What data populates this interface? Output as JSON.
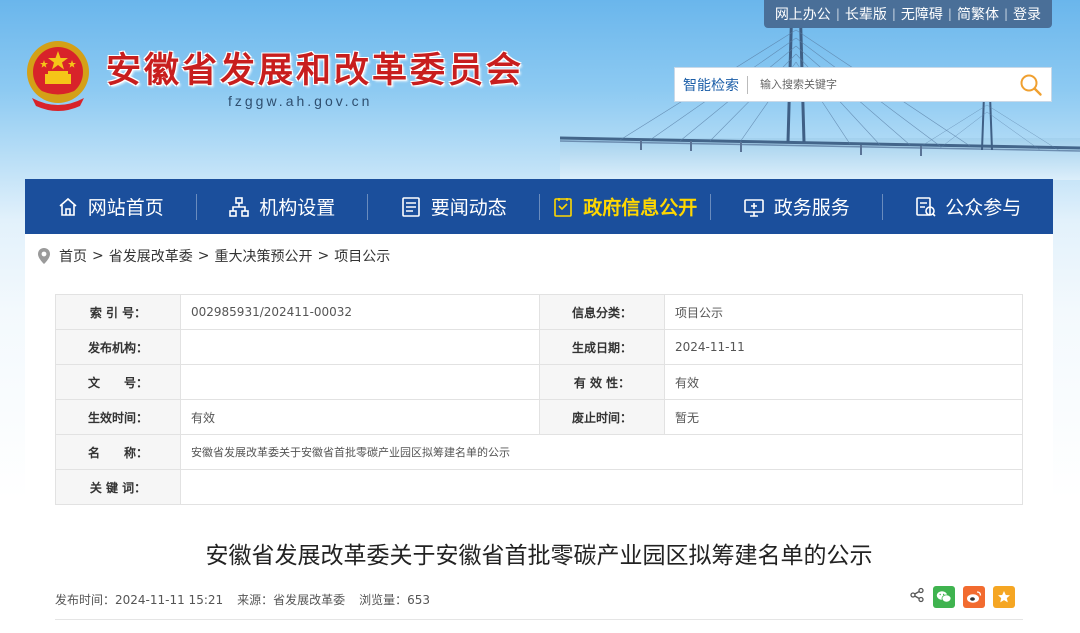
{
  "header": {
    "title": "安徽省发展和改革委员会",
    "domain": "fzggw.ah.gov.cn",
    "toplinks": [
      "网上办公",
      "长辈版",
      "无障碍",
      "简繁体",
      "登录"
    ],
    "search": {
      "label": "智能检索",
      "placeholder": "输入搜索关键字"
    }
  },
  "nav": {
    "items": [
      {
        "label": "网站首页",
        "icon": "home-icon"
      },
      {
        "label": "机构设置",
        "icon": "org-icon"
      },
      {
        "label": "要闻动态",
        "icon": "news-icon"
      },
      {
        "label": "政府信息公开",
        "icon": "info-open-icon",
        "active": true
      },
      {
        "label": "政务服务",
        "icon": "service-icon"
      },
      {
        "label": "公众参与",
        "icon": "participate-icon"
      }
    ]
  },
  "breadcrumb": [
    "首页",
    "省发展改革委",
    "重大决策预公开",
    "项目公示"
  ],
  "info": {
    "rows": [
      [
        {
          "k": "索 引 号：",
          "v": "002985931/202411-00032"
        },
        {
          "k": "信息分类：",
          "v": "项目公示"
        }
      ],
      [
        {
          "k": "发布机构：",
          "v": ""
        },
        {
          "k": "生成日期：",
          "v": "2024-11-11"
        }
      ],
      [
        {
          "k": "文　　号：",
          "v": ""
        },
        {
          "k": "有 效 性：",
          "v": "有效"
        }
      ],
      [
        {
          "k": "生效时间：",
          "v": "有效"
        },
        {
          "k": "废止时间：",
          "v": "暂无"
        }
      ]
    ],
    "name_label": "名　　称：",
    "name_value": "安徽省发展改革委关于安徽省首批零碳产业园区拟筹建名单的公示",
    "keyword_label": "关 键 词：",
    "keyword_value": ""
  },
  "article": {
    "title": "安徽省发展改革委关于安徽省首批零碳产业园区拟筹建名单的公示",
    "publish_time": "发布时间：2024-11-11 15:21",
    "source": "来源：省发展改革委",
    "views": "浏览量：653"
  },
  "colors": {
    "nav_bg": "#1b4f9c",
    "title_red": "#c81e1e",
    "active_yellow": "#ffd700"
  }
}
